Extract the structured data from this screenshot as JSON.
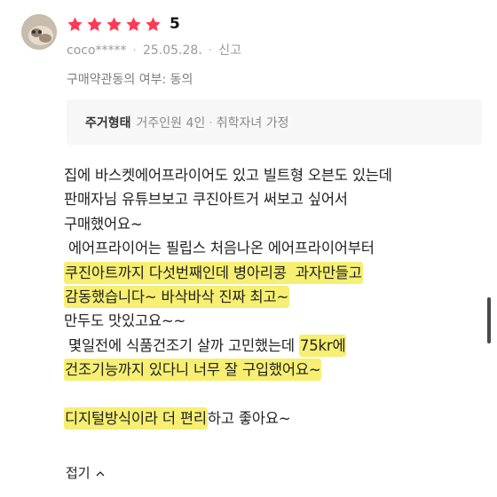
{
  "reviewer": {
    "avatar": "user-avatar",
    "rating": "5",
    "username": "coco*****",
    "date": "25.05.28.",
    "report_label": "신고"
  },
  "consent_line": "구매약관동의 여부: 동의",
  "household": {
    "label": "주거형태",
    "values": [
      "거주인원 4인",
      "취학자녀 가정"
    ],
    "separator": "·"
  },
  "review_lines": [
    {
      "segments": [
        {
          "text": "집에 바스켓에어프라이어도 있고 빌트형 오븐도 있는데",
          "hl": false
        }
      ]
    },
    {
      "segments": [
        {
          "text": "판매자님 유튜브보고 쿠진아트거 써보고 싶어서",
          "hl": false
        }
      ]
    },
    {
      "segments": [
        {
          "text": "구매했어요~",
          "hl": false
        }
      ]
    },
    {
      "segments": [
        {
          "text": " 에어프라이어는 필립스 처음나온 에어프라이어부터",
          "hl": false
        }
      ]
    },
    {
      "segments": [
        {
          "text": "쿠진아트까지 다섯번째인데 병아리콩  과자만들고",
          "hl": true
        }
      ]
    },
    {
      "segments": [
        {
          "text": "감동했습니다~ 바삭바삭 진짜 최고~",
          "hl": true
        }
      ]
    },
    {
      "segments": [
        {
          "text": "만두도 맛있고요~~",
          "hl": false
        }
      ]
    },
    {
      "segments": [
        {
          "text": " 몇일전에 식품건조기 살까 고민했는데 ",
          "hl": false
        },
        {
          "text": "75kr에",
          "hl": true
        }
      ]
    },
    {
      "segments": [
        {
          "text": "건조기능까지 있다니 너무 잘 구입했어요~",
          "hl": true
        }
      ]
    },
    {
      "segments": []
    },
    {
      "segments": [
        {
          "text": "디지털방식이라 더 편리",
          "hl": true
        },
        {
          "text": "하고 좋아요~",
          "hl": false
        }
      ]
    }
  ],
  "collapse_label": "접기",
  "colors": {
    "star": "#ff3a55",
    "highlight": "#f6ef72",
    "muted_text": "#9a9a9a",
    "panel_bg": "#f7f7f8"
  }
}
